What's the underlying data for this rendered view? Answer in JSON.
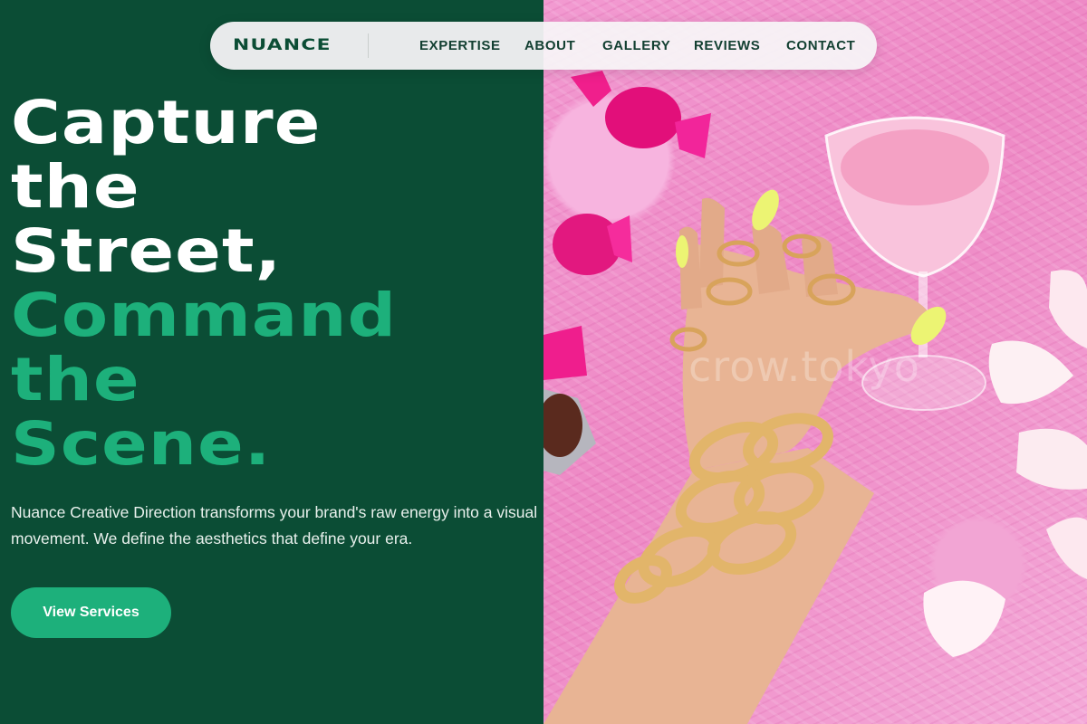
{
  "nav": {
    "logo": "NUANCE",
    "links": [
      "EXPERTISE",
      "ABOUT",
      "GALLERY",
      "REVIEWS",
      "CONTACT"
    ]
  },
  "hero": {
    "headline_white": [
      "Capture",
      "the",
      "Street,"
    ],
    "headline_green": [
      "Command",
      "the",
      "Scene."
    ],
    "description": "Nuance Creative Direction transforms your brand's raw energy into a visual movement. We define the aesthetics that define your era.",
    "cta_label": "View Services"
  },
  "image": {
    "watermark": "crow.tokyo"
  },
  "colors": {
    "panel_green": "#0b4d35",
    "accent_green": "#1db07b",
    "nav_background": "#f7f4f6",
    "photo_pink": "#f29ad1"
  }
}
